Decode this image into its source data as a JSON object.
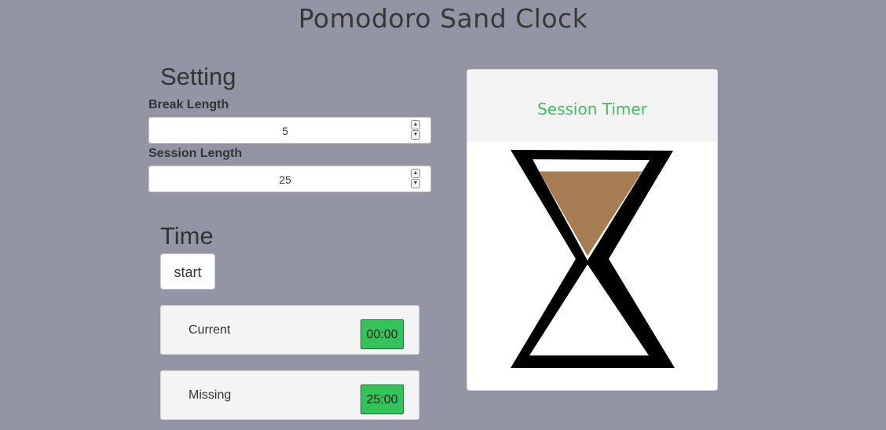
{
  "app": {
    "title": "Pomodoro Sand Clock"
  },
  "settings": {
    "heading": "Setting",
    "break_label": "Break Length",
    "break_value": "5",
    "session_label": "Session Length",
    "session_value": "25"
  },
  "time": {
    "heading": "Time",
    "start_label": "start",
    "current_label": "Current",
    "current_value": "00:00",
    "missing_label": "Missing",
    "missing_value": "25:00"
  },
  "clock": {
    "header": "Session Timer",
    "sand_fill_fraction": 0.88
  },
  "colors": {
    "background": "#9395a4",
    "accent_green": "#34c35a",
    "header_green": "#3fbd63",
    "sand": "#a67c52"
  },
  "icons": {
    "spinner_up": "chevron-up-icon",
    "spinner_down": "chevron-down-icon"
  }
}
